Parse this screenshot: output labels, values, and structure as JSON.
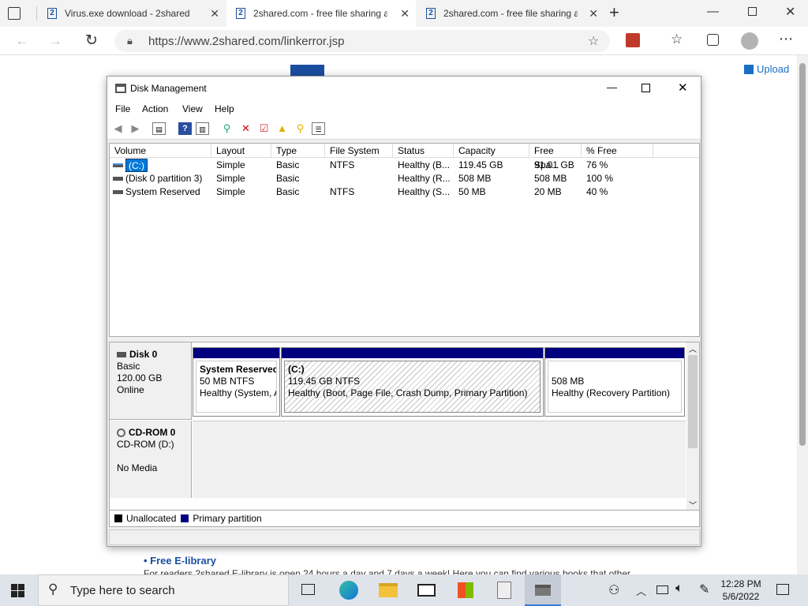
{
  "browser": {
    "tabs": [
      {
        "title": "Virus.exe download - 2shared",
        "active": false
      },
      {
        "title": "2shared.com - free file sharing a",
        "active": true
      },
      {
        "title": "2shared.com - free file sharing a",
        "active": false
      }
    ],
    "favicon_glyph": "2",
    "new_tab_glyph": "+",
    "url": "https://www.2shared.com/linkerror.jsp",
    "upload_label": "Upload"
  },
  "page": {
    "library_title": "• Free E-library",
    "library_text": "For readers 2shared E-library is open 24 hours a day and 7 days a week! Here you can find various books that other"
  },
  "dialog": {
    "title": "Disk Management",
    "menu": [
      "File",
      "Action",
      "View",
      "Help"
    ],
    "columns": [
      "Volume",
      "Layout",
      "Type",
      "File System",
      "Status",
      "Capacity",
      "Free Spa...",
      "% Free"
    ],
    "rows": [
      {
        "volume": "(C:)",
        "layout": "Simple",
        "type": "Basic",
        "fs": "NTFS",
        "status": "Healthy (B...",
        "capacity": "119.45 GB",
        "free": "91.01 GB",
        "pct": "76 %"
      },
      {
        "volume": "(Disk 0 partition 3)",
        "layout": "Simple",
        "type": "Basic",
        "fs": "",
        "status": "Healthy (R...",
        "capacity": "508 MB",
        "free": "508 MB",
        "pct": "100 %"
      },
      {
        "volume": "System Reserved",
        "layout": "Simple",
        "type": "Basic",
        "fs": "NTFS",
        "status": "Healthy (S...",
        "capacity": "50 MB",
        "free": "20 MB",
        "pct": "40 %"
      }
    ],
    "disk0": {
      "name": "Disk 0",
      "type": "Basic",
      "size": "120.00 GB",
      "state": "Online"
    },
    "partitions": [
      {
        "name": "System Reserved",
        "size": "50 MB NTFS",
        "status": "Healthy (System, A"
      },
      {
        "name": "(C:)",
        "size": "119.45 GB NTFS",
        "status": "Healthy (Boot, Page File, Crash Dump, Primary Partition)"
      },
      {
        "name": "",
        "size": "508 MB",
        "status": "Healthy (Recovery Partition)"
      }
    ],
    "cdrom": {
      "name": "CD-ROM 0",
      "drive": "CD-ROM (D:)",
      "media": "No Media"
    },
    "legend": {
      "unallocated": "Unallocated",
      "primary": "Primary partition"
    },
    "colors": {
      "primary": "#00007f",
      "unallocated": "#000000"
    }
  },
  "taskbar": {
    "search_placeholder": "Type here to search",
    "time": "12:28 PM",
    "date": "5/6/2022"
  }
}
